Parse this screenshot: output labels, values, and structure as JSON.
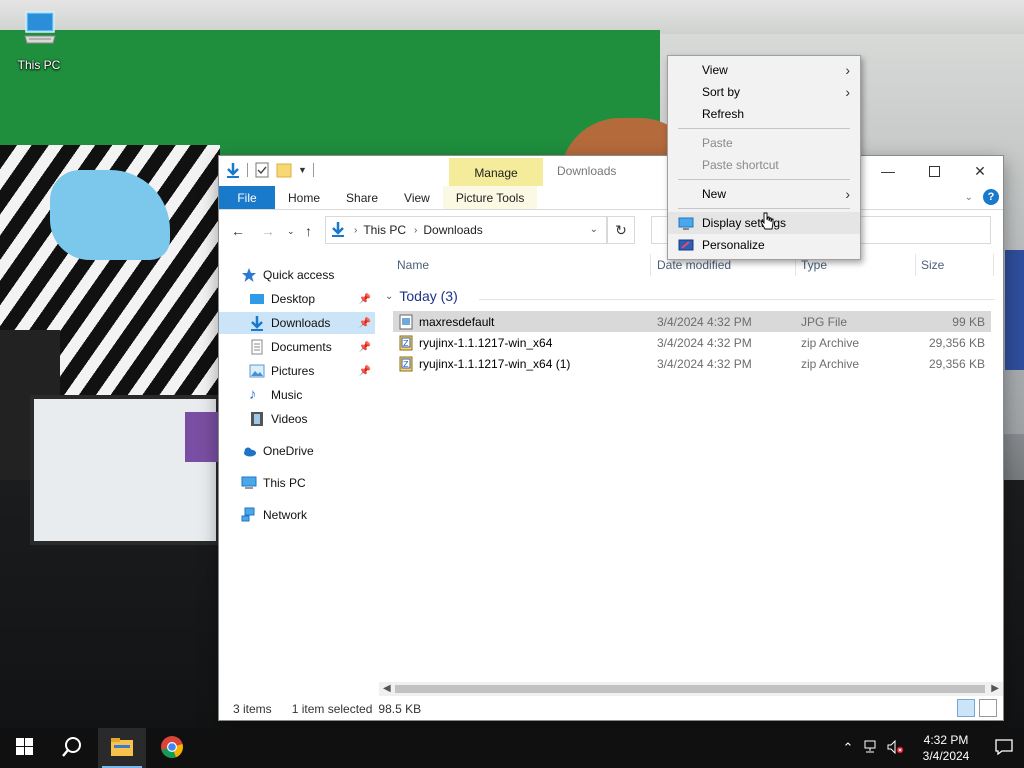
{
  "desktop": {
    "icons": [
      {
        "label": "This PC",
        "icon": "this-pc-icon"
      }
    ]
  },
  "explorer": {
    "title": "Downloads",
    "context_tab_header": "Manage",
    "ribbon_tabs": [
      "File",
      "Home",
      "Share",
      "View",
      "Picture Tools"
    ],
    "address": {
      "segments": [
        "This PC",
        "Downloads"
      ]
    },
    "nav": [
      {
        "label": "Quick access",
        "icon": "star-icon",
        "pinned": false
      },
      {
        "label": "Desktop",
        "icon": "desktop-folder-icon",
        "pinned": true
      },
      {
        "label": "Downloads",
        "icon": "download-icon",
        "pinned": true,
        "selected": true
      },
      {
        "label": "Documents",
        "icon": "documents-icon",
        "pinned": true
      },
      {
        "label": "Pictures",
        "icon": "pictures-icon",
        "pinned": true
      },
      {
        "label": "Music",
        "icon": "music-icon",
        "pinned": false
      },
      {
        "label": "Videos",
        "icon": "videos-icon",
        "pinned": false
      },
      {
        "label": "OneDrive",
        "icon": "onedrive-icon",
        "pinned": false
      },
      {
        "label": "This PC",
        "icon": "this-pc-icon",
        "pinned": false
      },
      {
        "label": "Network",
        "icon": "network-icon",
        "pinned": false
      }
    ],
    "columns": [
      "Name",
      "Date modified",
      "Type",
      "Size"
    ],
    "group": "Today (3)",
    "files": [
      {
        "name": "maxresdefault",
        "date": "3/4/2024 4:32 PM",
        "type": "JPG File",
        "size": "99 KB",
        "icon": "image-file-icon",
        "selected": true
      },
      {
        "name": "ryujinx-1.1.1217-win_x64",
        "date": "3/4/2024 4:32 PM",
        "type": "zip Archive",
        "size": "29,356 KB",
        "icon": "zip-file-icon",
        "selected": false
      },
      {
        "name": "ryujinx-1.1.1217-win_x64 (1)",
        "date": "3/4/2024 4:32 PM",
        "type": "zip Archive",
        "size": "29,356 KB",
        "icon": "zip-file-icon",
        "selected": false
      }
    ],
    "status": {
      "items": "3 items",
      "selected": "1 item selected",
      "size": "98.5 KB"
    }
  },
  "context_menu": {
    "items": [
      {
        "label": "View",
        "submenu": true,
        "disabled": false
      },
      {
        "label": "Sort by",
        "submenu": true,
        "disabled": false
      },
      {
        "label": "Refresh",
        "submenu": false,
        "disabled": false
      },
      {
        "label": "Paste",
        "submenu": false,
        "disabled": true
      },
      {
        "label": "Paste shortcut",
        "submenu": false,
        "disabled": true
      },
      {
        "label": "New",
        "submenu": true,
        "disabled": false
      },
      {
        "label": "Display settings",
        "submenu": false,
        "disabled": false,
        "highlighted": true,
        "icon": "display-icon"
      },
      {
        "label": "Personalize",
        "submenu": false,
        "disabled": false,
        "icon": "personalize-icon"
      }
    ]
  },
  "taskbar": {
    "apps": [
      {
        "name": "start",
        "icon": "windows-start-icon"
      },
      {
        "name": "search",
        "icon": "search-icon"
      },
      {
        "name": "file-explorer",
        "icon": "file-explorer-icon",
        "active": true
      },
      {
        "name": "chrome",
        "icon": "chrome-icon"
      }
    ],
    "clock": {
      "time": "4:32 PM",
      "date": "3/4/2024"
    }
  },
  "colors": {
    "accent": "#1979ca",
    "selection": "#cce4f7",
    "manage_tab": "#f4ec9a",
    "taskbar": "#101010"
  }
}
